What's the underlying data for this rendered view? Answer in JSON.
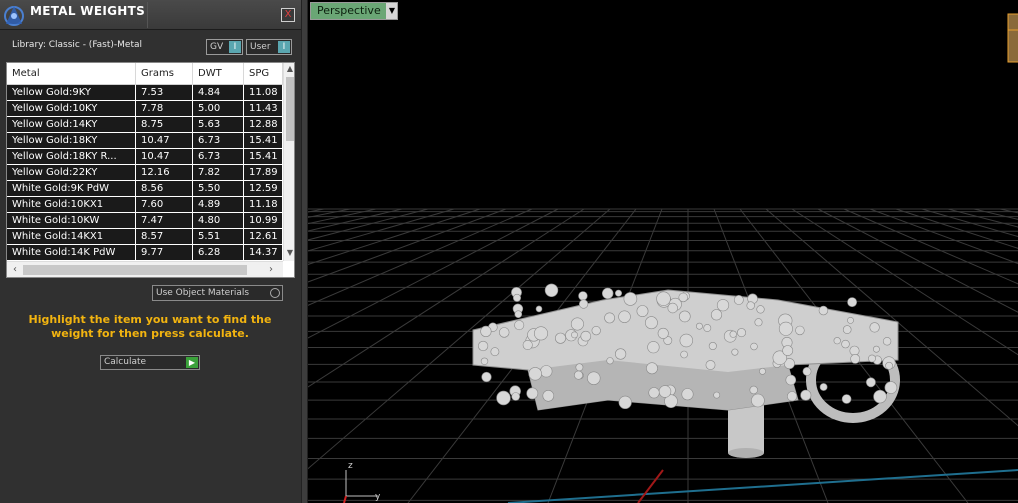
{
  "panel": {
    "title": "METAL WEIGHTS",
    "close_label": "X",
    "library_label": "Library: Classic - (Fast)-Metal",
    "toggles": [
      {
        "label": "GV",
        "indicator": "I"
      },
      {
        "label": "User",
        "indicator": "I"
      }
    ],
    "table": {
      "headers": [
        "Metal",
        "Grams",
        "DWT",
        "SPG"
      ],
      "rows": [
        [
          "Yellow Gold:9KY",
          "7.53",
          "4.84",
          "11.08"
        ],
        [
          "Yellow Gold:10KY",
          "7.78",
          "5.00",
          "11.43"
        ],
        [
          "Yellow Gold:14KY",
          "8.75",
          "5.63",
          "12.88"
        ],
        [
          "Yellow Gold:18KY",
          "10.47",
          "6.73",
          "15.41"
        ],
        [
          "Yellow Gold:18KY R...",
          "10.47",
          "6.73",
          "15.41"
        ],
        [
          "Yellow Gold:22KY",
          "12.16",
          "7.82",
          "17.89"
        ],
        [
          "White Gold:9K PdW",
          "8.56",
          "5.50",
          "12.59"
        ],
        [
          "White Gold:10KX1",
          "7.60",
          "4.89",
          "11.18"
        ],
        [
          "White Gold:10KW",
          "7.47",
          "4.80",
          "10.99"
        ],
        [
          "White Gold:14KX1",
          "8.57",
          "5.51",
          "12.61"
        ],
        [
          "White Gold:14K PdW",
          "9.77",
          "6.28",
          "14.37"
        ]
      ]
    },
    "use_object_materials": "Use Object Materials",
    "instruction": "Highlight the item you want to find the weight for then press calculate.",
    "calculate_label": "Calculate"
  },
  "viewport": {
    "view_name": "Perspective",
    "axis_z": "z",
    "axis_y": "y",
    "colors": {
      "background": "#000000",
      "grid": "#3a3a3a",
      "label_bg": "#6aa675",
      "model": "#d8d8d8"
    }
  }
}
